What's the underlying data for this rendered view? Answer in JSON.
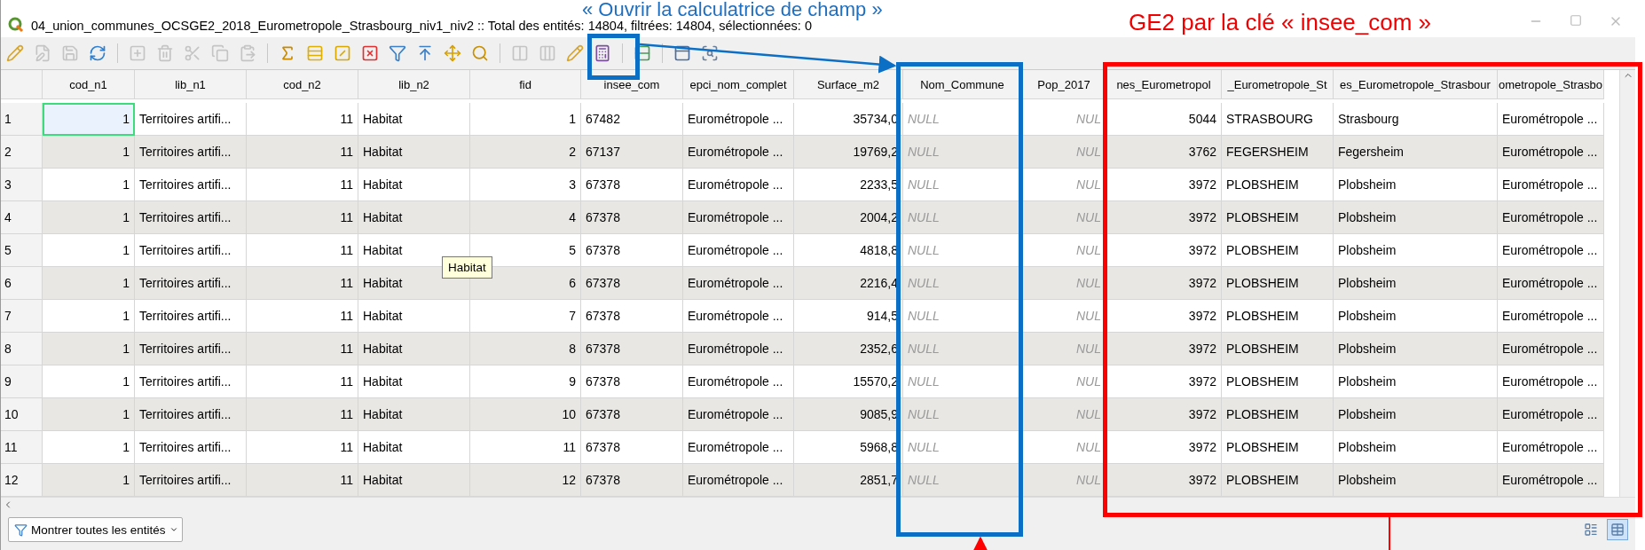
{
  "window": {
    "title": "04_union_communes_OCSGE2_2018_Eurometropole_Strasbourg_niv1_niv2 :: Total des entités: 14804, filtrées: 14804, sélectionnées: 0"
  },
  "annotations": {
    "calculator_note": "« Ouvrir la calculatrice de champ »",
    "join_note": "GE2 par la clé « insee_com »"
  },
  "toolbar": [
    {
      "kind": "pencil",
      "disabled": false
    },
    {
      "kind": "multi_edit",
      "disabled": true
    },
    {
      "kind": "save",
      "disabled": true
    },
    {
      "kind": "reload",
      "disabled": false
    },
    {
      "kind": "separator"
    },
    {
      "kind": "add",
      "disabled": true
    },
    {
      "kind": "delete",
      "disabled": true
    },
    {
      "kind": "cut",
      "disabled": true
    },
    {
      "kind": "copy",
      "disabled": true
    },
    {
      "kind": "paste",
      "disabled": true
    },
    {
      "kind": "separator"
    },
    {
      "kind": "expression",
      "disabled": false
    },
    {
      "kind": "select_all",
      "disabled": false
    },
    {
      "kind": "invert",
      "disabled": false
    },
    {
      "kind": "deselect",
      "disabled": false
    },
    {
      "kind": "filter",
      "disabled": false
    },
    {
      "kind": "move_top",
      "disabled": false
    },
    {
      "kind": "pan",
      "disabled": false
    },
    {
      "kind": "zoom",
      "disabled": false
    },
    {
      "kind": "separator"
    },
    {
      "kind": "new_field",
      "disabled": true
    },
    {
      "kind": "delete_field",
      "disabled": true
    },
    {
      "kind": "pencil",
      "disabled": false
    },
    {
      "kind": "calculator",
      "disabled": false
    },
    {
      "kind": "separator"
    },
    {
      "kind": "conditional",
      "disabled": false
    },
    {
      "kind": "separator"
    },
    {
      "kind": "dock",
      "disabled": false
    },
    {
      "kind": "actions",
      "disabled": false
    }
  ],
  "table": {
    "columns": [
      {
        "label": "cod_n1",
        "kind": "number",
        "empty": false
      },
      {
        "label": "lib_n1",
        "kind": "text",
        "empty": false
      },
      {
        "label": "cod_n2",
        "kind": "number",
        "empty": false
      },
      {
        "label": "lib_n2",
        "kind": "text",
        "empty": false
      },
      {
        "label": "fid",
        "kind": "number",
        "empty": false
      },
      {
        "label": "insee_com",
        "kind": "text",
        "empty": false
      },
      {
        "label": "epci_nom_complet",
        "kind": "text",
        "empty": false
      },
      {
        "label": "Surface_m2",
        "kind": "number",
        "empty": false
      },
      {
        "label": "Nom_Commune",
        "kind": "text",
        "empty": true
      },
      {
        "label": "Pop_2017",
        "kind": "number",
        "empty": true
      },
      {
        "label": "nes_Eurometropol",
        "kind": "number",
        "empty": false
      },
      {
        "label": "_Eurometropole_St",
        "kind": "text",
        "empty": false
      },
      {
        "label": "es_Eurometropole_Strasbour",
        "kind": "text",
        "empty": false
      },
      {
        "label": "ometropole_Strasbo",
        "kind": "text",
        "empty": false
      }
    ],
    "rows": [
      {
        "number": "1",
        "focused": true,
        "cells": [
          "1",
          "Territoires artifi...",
          "11",
          "Habitat",
          "1",
          "67482",
          "Eurométropole ...",
          "35734,0",
          "NULL",
          "NUL",
          "5044",
          "STRASBOURG",
          "Strasbourg",
          "Eurométropole ..."
        ]
      },
      {
        "number": "2",
        "focused": false,
        "cells": [
          "1",
          "Territoires artifi...",
          "11",
          "Habitat",
          "2",
          "67137",
          "Eurométropole ...",
          "19769,2",
          "NULL",
          "NUL",
          "3762",
          "FEGERSHEIM",
          "Fegersheim",
          "Eurométropole ..."
        ]
      },
      {
        "number": "3",
        "focused": false,
        "cells": [
          "1",
          "Territoires artifi...",
          "11",
          "Habitat",
          "3",
          "67378",
          "Eurométropole ...",
          "2233,5",
          "NULL",
          "NUL",
          "3972",
          "PLOBSHEIM",
          "Plobsheim",
          "Eurométropole ..."
        ]
      },
      {
        "number": "4",
        "focused": false,
        "cells": [
          "1",
          "Territoires artifi...",
          "11",
          "Habitat",
          "4",
          "67378",
          "Eurométropole ...",
          "2004,2",
          "NULL",
          "NUL",
          "3972",
          "PLOBSHEIM",
          "Plobsheim",
          "Eurométropole ..."
        ]
      },
      {
        "number": "5",
        "focused": false,
        "cells": [
          "1",
          "Territoires artifi...",
          "11",
          "Habitat",
          "5",
          "67378",
          "Eurométropole ...",
          "4818,8",
          "NULL",
          "NUL",
          "3972",
          "PLOBSHEIM",
          "Plobsheim",
          "Eurométropole ..."
        ]
      },
      {
        "number": "6",
        "focused": false,
        "cells": [
          "1",
          "Territoires artifi...",
          "11",
          "Habitat",
          "6",
          "67378",
          "Eurométropole ...",
          "2216,4",
          "NULL",
          "NUL",
          "3972",
          "PLOBSHEIM",
          "Plobsheim",
          "Eurométropole ..."
        ]
      },
      {
        "number": "7",
        "focused": false,
        "cells": [
          "1",
          "Territoires artifi...",
          "11",
          "Habitat",
          "7",
          "67378",
          "Eurométropole ...",
          "914,5",
          "NULL",
          "NUL",
          "3972",
          "PLOBSHEIM",
          "Plobsheim",
          "Eurométropole ..."
        ]
      },
      {
        "number": "8",
        "focused": false,
        "cells": [
          "1",
          "Territoires artifi...",
          "11",
          "Habitat",
          "8",
          "67378",
          "Eurométropole ...",
          "2352,6",
          "NULL",
          "NUL",
          "3972",
          "PLOBSHEIM",
          "Plobsheim",
          "Eurométropole ..."
        ]
      },
      {
        "number": "9",
        "focused": false,
        "cells": [
          "1",
          "Territoires artifi...",
          "11",
          "Habitat",
          "9",
          "67378",
          "Eurométropole ...",
          "15570,2",
          "NULL",
          "NUL",
          "3972",
          "PLOBSHEIM",
          "Plobsheim",
          "Eurométropole ..."
        ]
      },
      {
        "number": "10",
        "focused": false,
        "cells": [
          "1",
          "Territoires artifi...",
          "11",
          "Habitat",
          "10",
          "67378",
          "Eurométropole ...",
          "9085,9",
          "NULL",
          "NUL",
          "3972",
          "PLOBSHEIM",
          "Plobsheim",
          "Eurométropole ..."
        ]
      },
      {
        "number": "11",
        "focused": false,
        "cells": [
          "1",
          "Territoires artifi...",
          "11",
          "Habitat",
          "11",
          "67378",
          "Eurométropole ...",
          "5968,8",
          "NULL",
          "NUL",
          "3972",
          "PLOBSHEIM",
          "Plobsheim",
          "Eurométropole ..."
        ]
      },
      {
        "number": "12",
        "focused": false,
        "cells": [
          "1",
          "Territoires artifi...",
          "11",
          "Habitat",
          "12",
          "67378",
          "Eurométropole ...",
          "2851,7",
          "NULL",
          "NUL",
          "3972",
          "PLOBSHEIM",
          "Plobsheim",
          "Eurométropole ..."
        ]
      }
    ],
    "tooltip": "Habitat"
  },
  "bottom_bar": {
    "filter_button": "Montrer toutes les entités",
    "views": [
      {
        "kind": "form",
        "selected": false
      },
      {
        "kind": "table",
        "selected": true
      }
    ]
  }
}
